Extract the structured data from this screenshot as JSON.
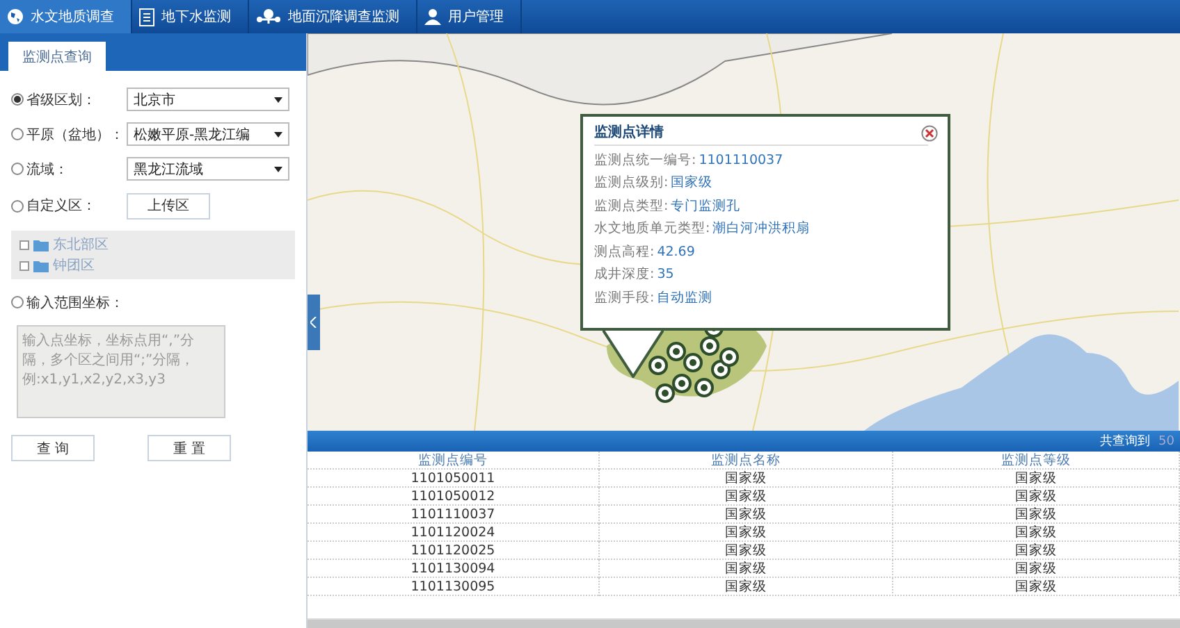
{
  "nav": [
    {
      "label": "水文地质调查",
      "kind": "globe",
      "selected": true
    },
    {
      "label": "地下水监测",
      "kind": "document",
      "selected": false
    },
    {
      "label": "地面沉降调查监测",
      "kind": "network",
      "selected": false
    },
    {
      "label": "用户管理",
      "kind": "user",
      "selected": false
    }
  ],
  "sidebar": {
    "tabs": [
      {
        "label": "监测点查询",
        "selected": true
      }
    ],
    "filters": [
      {
        "kind": "select",
        "label": "省级区划：",
        "value": "北京市",
        "selected": true
      },
      {
        "kind": "select",
        "label": "平原（盆地）：",
        "value": "松嫩平原-黑龙江编",
        "selected": false
      },
      {
        "kind": "select",
        "label": "流域：",
        "value": "黑龙江流域",
        "selected": false
      },
      {
        "kind": "upload",
        "label": "自定义区：",
        "button": "上传区",
        "selected": false,
        "tree": [
          "东北部区",
          "钟团区"
        ]
      },
      {
        "kind": "coords",
        "label": "输入范围坐标：",
        "placeholder": "输入点坐标，坐标点用“,”分隔，多个区之间用“;”分隔，例:x1,y1,x2,y2,x3,y3",
        "selected": false
      }
    ],
    "buttons": [
      "查 询",
      "重 置"
    ]
  },
  "popup": {
    "title": "监测点详情",
    "fields": [
      {
        "label": "监测点统一编号:",
        "value": "1101110037"
      },
      {
        "label": "监测点级别:",
        "value": "国家级"
      },
      {
        "label": "监测点类型:",
        "value": "专门监测孔"
      },
      {
        "label": "水文地质单元类型:",
        "value": "潮白河冲洪积扇"
      },
      {
        "label": "测点高程:",
        "value": "42.69"
      },
      {
        "label": "成井深度:",
        "value": "35"
      },
      {
        "label": "监测手段:",
        "value": "自动监测"
      }
    ]
  },
  "results": {
    "prefix": "共查询到",
    "count": "50"
  },
  "table": {
    "columns": [
      "监测点编号",
      "监测点名称",
      "监测点等级"
    ],
    "rows": [
      [
        "1101050011",
        "国家级",
        "国家级"
      ],
      [
        "1101050012",
        "国家级",
        "国家级"
      ],
      [
        "1101110037",
        "国家级",
        "国家级"
      ],
      [
        "1101120024",
        "国家级",
        "国家级"
      ],
      [
        "1101120025",
        "国家级",
        "国家级"
      ],
      [
        "1101130094",
        "国家级",
        "国家级"
      ],
      [
        "1101130095",
        "国家级",
        "国家级"
      ]
    ]
  }
}
